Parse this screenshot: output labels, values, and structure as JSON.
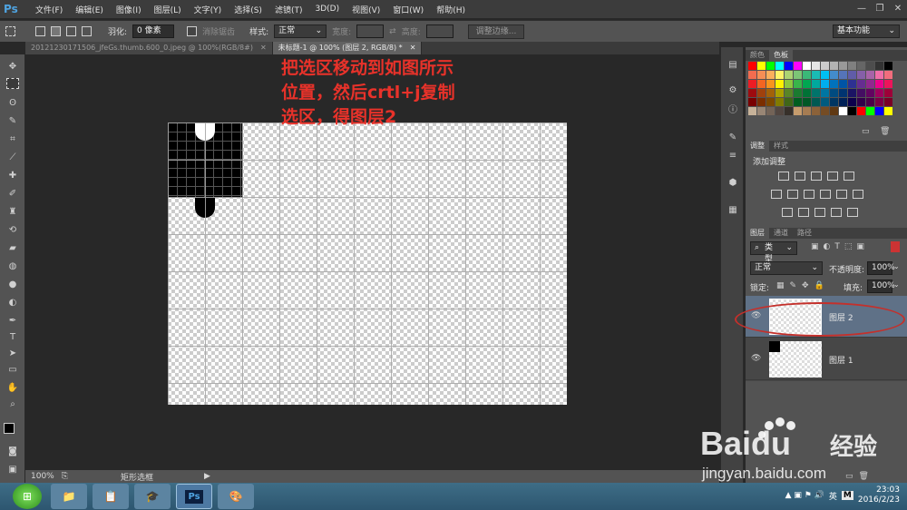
{
  "app": {
    "logo": "Ps"
  },
  "menu": [
    "文件(F)",
    "编辑(E)",
    "图像(I)",
    "图层(L)",
    "文字(Y)",
    "选择(S)",
    "滤镜(T)",
    "3D(D)",
    "视图(V)",
    "窗口(W)",
    "帮助(H)"
  ],
  "window_controls": {
    "minimize": "—",
    "restore": "❐",
    "close": "✕"
  },
  "options": {
    "feather_label": "羽化:",
    "feather_value": "0 像素",
    "antialias_label": "消除锯齿",
    "style_label": "样式:",
    "style_value": "正常",
    "width_label": "宽度:",
    "height_label": "高度:",
    "refine_edge": "调整边缘...",
    "workspace": "基本功能"
  },
  "tabs": [
    {
      "label": "20121230171506_jfeGs.thumb.600_0.jpeg @ 100%(RGB/8#)",
      "close": "✕",
      "active": false
    },
    {
      "label": "未标题-1 @ 100% (图层 2, RGB/8) *",
      "close": "✕",
      "active": true
    }
  ],
  "annotation": {
    "line1": "把选区移动到如图所示",
    "line2": "位置，然后crtl+j复制",
    "line3": "选区，得图层2"
  },
  "status": {
    "zoom": "100%",
    "tool_name": "矩形选框"
  },
  "swatches_panel": {
    "tab1": "颜色",
    "tab2": "色板"
  },
  "swatch_colors": [
    "#ff0000",
    "#ffff00",
    "#00ff00",
    "#00ffff",
    "#0000ff",
    "#ff00ff",
    "#ffffff",
    "#e6e6e6",
    "#cccccc",
    "#b3b3b3",
    "#999999",
    "#808080",
    "#666666",
    "#4d4d4d",
    "#333333",
    "#000000",
    "#f26c4f",
    "#f68e55",
    "#fbaf5c",
    "#fff467",
    "#acd372",
    "#7cc576",
    "#3bb878",
    "#1abbb4",
    "#00bff3",
    "#438ccb",
    "#5574b9",
    "#605ca8",
    "#855fa8",
    "#a763a8",
    "#f06ea9",
    "#f26d7d",
    "#ed1c24",
    "#f26522",
    "#f7941d",
    "#fff200",
    "#8dc73f",
    "#39b54a",
    "#00a651",
    "#00a99d",
    "#00aeef",
    "#0072bc",
    "#0054a6",
    "#2e3192",
    "#662d91",
    "#92278f",
    "#ec008c",
    "#ed145b",
    "#9e0b0f",
    "#a0410d",
    "#a36209",
    "#aba000",
    "#598527",
    "#1a7b30",
    "#007236",
    "#00746b",
    "#0076a3",
    "#004b80",
    "#003471",
    "#1b1464",
    "#440e62",
    "#630460",
    "#9e005d",
    "#9e0039",
    "#790000",
    "#7b2e00",
    "#7d4900",
    "#827b00",
    "#406618",
    "#005e20",
    "#005826",
    "#005952",
    "#005b7f",
    "#003663",
    "#002157",
    "#0d004c",
    "#32004b",
    "#4b0049",
    "#7b0046",
    "#7a0026",
    "#c7b299",
    "#998675",
    "#736357",
    "#534741",
    "#37302a",
    "#c69c6d",
    "#a67c52",
    "#8c6239",
    "#754c24",
    "#603913",
    "#ffffff",
    "#000000",
    "#ff0000",
    "#00ff00",
    "#0000ff",
    "#ffff00"
  ],
  "adjustments_panel": {
    "tab1": "调整",
    "tab2": "样式",
    "title": "添加调整"
  },
  "layers_panel": {
    "tab1": "图层",
    "tab2": "通道",
    "tab3": "路径",
    "filter_kind": "类型",
    "blend_mode": "正常",
    "opacity_label": "不透明度:",
    "opacity_value": "100%",
    "lock_label": "锁定:",
    "fill_label": "填充:",
    "fill_value": "100%",
    "layers": [
      {
        "name": "图层 2",
        "selected": true
      },
      {
        "name": "图层 1",
        "selected": false
      }
    ]
  },
  "taskbar": {
    "clock_time": "23:03",
    "clock_date": "2016/2/23",
    "ime_label": "英",
    "ime_m": "M",
    "ps_label": "Ps"
  },
  "watermark": {
    "brand": "Baidu",
    "brand_cn": "经验",
    "url": "jingyan.baidu.com"
  }
}
